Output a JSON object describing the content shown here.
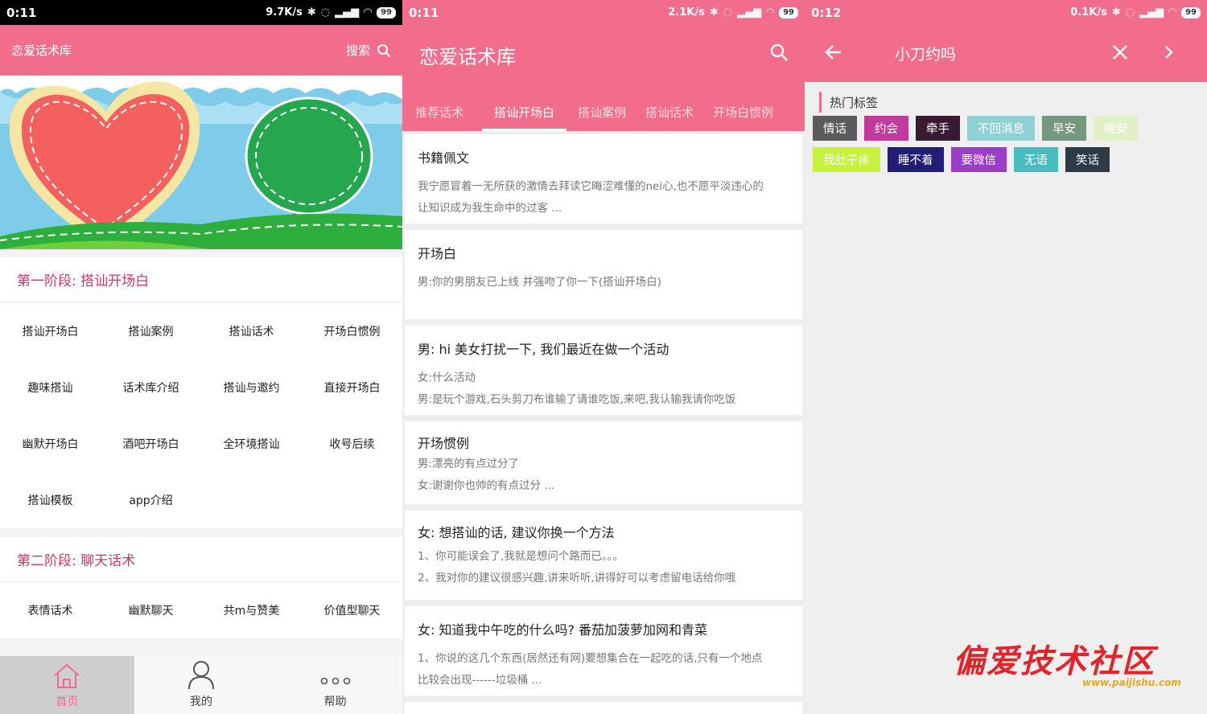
{
  "screen1": {
    "status": {
      "time": "0:11",
      "speed": "9.7K/s",
      "battery": "99"
    },
    "title": "恋爱话术库",
    "search_label": "搜索",
    "sections": [
      {
        "title": "第一阶段: 搭讪开场白",
        "items": [
          "搭讪开场白",
          "搭讪案例",
          "搭讪话术",
          "开场白惯例",
          "趣味搭讪",
          "话术库介绍",
          "搭讪与邀约",
          "直接开场白",
          "幽默开场白",
          "酒吧开场白",
          "全环境搭讪",
          "收号后续",
          "搭讪模板",
          "app介绍"
        ]
      },
      {
        "title": "第二阶段: 聊天话术",
        "items": [
          "表情话术",
          "幽默聊天",
          "共m与赞美",
          "价值型聊天"
        ]
      }
    ],
    "tabbar": [
      {
        "label": "首页",
        "icon": "home-icon"
      },
      {
        "label": "我的",
        "icon": "user-icon"
      },
      {
        "label": "帮助",
        "icon": "more-icon"
      }
    ]
  },
  "screen2": {
    "status": {
      "time": "0:11",
      "speed": "2.1K/s",
      "battery": "99"
    },
    "title": "恋爱话术库",
    "tabs": [
      "推荐话术",
      "搭讪开场白",
      "搭讪案例",
      "搭讪话术",
      "开场白惯例"
    ],
    "active_tab": 1,
    "cards": [
      {
        "title": "书籍佩文",
        "lines": [
          "我宁愿冒着一无所获的激情去拜读它晦涩难懂的nei心,也不愿平淡违心的",
          "让知识成为我生命中的过客 ..."
        ]
      },
      {
        "title": "开场白",
        "lines": [
          "男:你的男朋友已上线 并强吻了你一下(搭讪开场白)"
        ]
      },
      {
        "title": "男: hi 美女打扰一下, 我们最近在做一个活动",
        "lines": [
          "女:什么活动",
          "男:是玩个游戏,石头剪刀布谁输了请谁吃饭,来吧,我认输我请你吃饭"
        ]
      },
      {
        "title": "开场惯例",
        "lines": [
          "男:漂亮的有点过分了",
          "女:谢谢你也帅的有点过分 ..."
        ]
      },
      {
        "title": "女: 想搭讪的话, 建议你换一个方法",
        "lines": [
          "1、你可能误会了,我就是想问个路而已。。。",
          "2、我对你的建议很感兴趣,讲来听听,讲得好可以考虑留电话给你哦"
        ]
      },
      {
        "title": "女: 知道我中午吃的什么吗? 番茄加菠萝加网和青菜",
        "lines": [
          "1、你说的这几个东西(居然还有网)要想集合在一起吃的话,只有一个地点",
          "比较会出现------垃圾桶 ..."
        ]
      }
    ]
  },
  "screen3": {
    "status": {
      "time": "0:12",
      "speed": "0.1K/s",
      "battery": "99"
    },
    "query": "小刀约吗",
    "hot_label": "热门标签",
    "tags": [
      {
        "text": "情话",
        "color": "#5b5b5b"
      },
      {
        "text": "约会",
        "color": "#c03b9c"
      },
      {
        "text": "牵手",
        "color": "#3a1a32"
      },
      {
        "text": "不回消息",
        "color": "#8fd0d4"
      },
      {
        "text": "早安",
        "color": "#75987f"
      },
      {
        "text": "晚安",
        "color": "#e3efc4"
      },
      {
        "text": "我肚子疼",
        "color": "#c7f23c"
      },
      {
        "text": "睡不着",
        "color": "#221e78"
      },
      {
        "text": "要微信",
        "color": "#9c3dc8"
      },
      {
        "text": "无语",
        "color": "#48bcbe"
      },
      {
        "text": "笑话",
        "color": "#2d3b44"
      }
    ]
  },
  "watermark": {
    "text": "偏爱技术社区",
    "url": "www.paijishu.com"
  },
  "colors": {
    "accent": "#f26d8b",
    "section_title": "#c83a63"
  }
}
